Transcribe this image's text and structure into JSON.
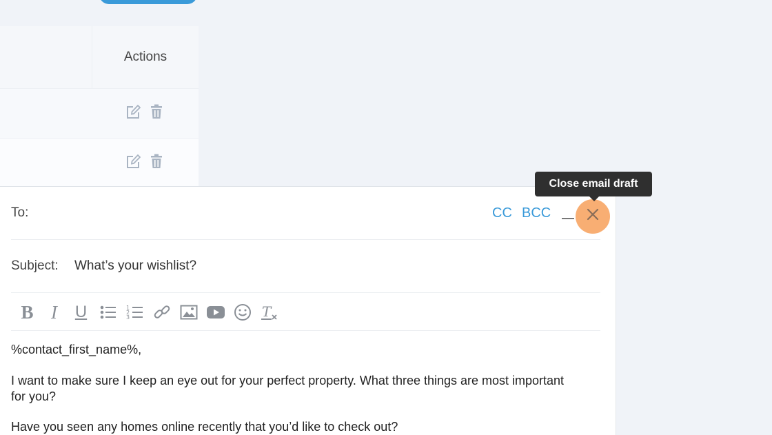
{
  "table": {
    "actions_header": "Actions",
    "rows": [
      {
        "actions": [
          "edit-icon",
          "trash-icon"
        ]
      },
      {
        "actions": [
          "edit-icon",
          "trash-icon"
        ]
      }
    ]
  },
  "composer": {
    "to_label": "To:",
    "to_value": "",
    "cc_label": "CC",
    "bcc_label": "BCC",
    "subject_label": "Subject:",
    "subject_value": "What’s your wishlist?",
    "toolbar_bold": "B",
    "toolbar_italic": "I",
    "toolbar_underline": "U",
    "toolbar": [
      "bold-icon",
      "italic-icon",
      "underline-icon",
      "bulleted-list-icon",
      "numbered-list-icon",
      "link-icon",
      "image-icon",
      "video-icon",
      "emoji-icon",
      "clear-format-icon"
    ],
    "body": {
      "greeting": "%contact_first_name%,",
      "para1": "I want to make sure I keep an eye out for your perfect property. What three things are most important for you?",
      "para2": "Have you seen any homes online recently that you’d like to check out?"
    }
  },
  "tooltip": {
    "text": "Close email draft"
  },
  "colors": {
    "accent": "#3a9ad9",
    "highlight": "#f7a05a",
    "tooltip_bg": "#2f2f2f",
    "background": "#f0f3f8"
  }
}
